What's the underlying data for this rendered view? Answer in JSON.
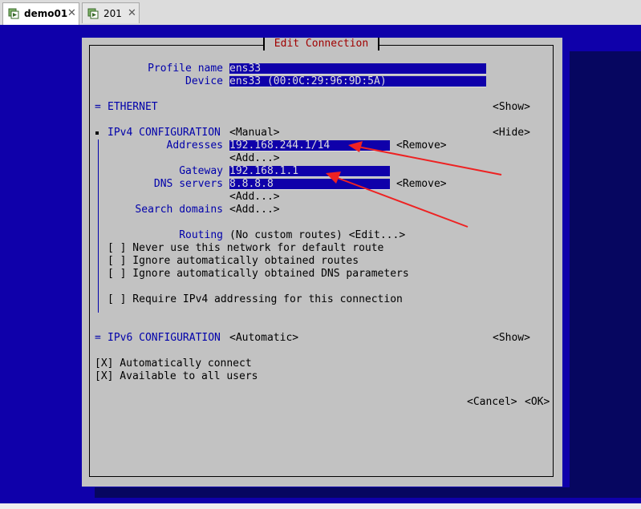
{
  "tabs": [
    {
      "label": "demo01",
      "active": true
    },
    {
      "label": "201",
      "active": false
    }
  ],
  "dialog": {
    "title": "Edit Connection",
    "profile_name_label": "Profile name",
    "profile_name_value": "ens33",
    "device_label": "Device",
    "device_value": "ens33 (00:0C:29:96:9D:5A)",
    "ethernet": {
      "marker": "=",
      "label": "ETHERNET",
      "toggle": "<Show>"
    },
    "ipv4": {
      "marker": "■",
      "label": "IPv4 CONFIGURATION",
      "mode": "<Manual>",
      "toggle": "<Hide>",
      "addresses_label": "Addresses",
      "address_value": "192.168.244.1/14",
      "remove_label": "<Remove>",
      "add_label": "<Add...>",
      "gateway_label": "Gateway",
      "gateway_value": "192.168.1.1",
      "dns_label": "DNS servers",
      "dns_value": "8.8.8.8",
      "search_label": "Search domains",
      "routing_label": "Routing",
      "routing_value": "(No custom routes) <Edit...>",
      "checkboxes": [
        "[ ] Never use this network for default route",
        "[ ] Ignore automatically obtained routes",
        "[ ] Ignore automatically obtained DNS parameters",
        "[ ] Require IPv4 addressing for this connection"
      ]
    },
    "ipv6": {
      "marker": "=",
      "label": "IPv6 CONFIGURATION",
      "mode": "<Automatic>",
      "toggle": "<Show>"
    },
    "auto_connect": "[X] Automatically connect",
    "all_users": "[X] Available to all users",
    "cancel": "<Cancel>",
    "ok": "<OK>"
  },
  "colors": {
    "screen_bg": "#0f00aa",
    "dialog_bg": "#c2c2c2",
    "title": "#a00000",
    "label": "#0000aa",
    "arrow": "#ee2222"
  }
}
